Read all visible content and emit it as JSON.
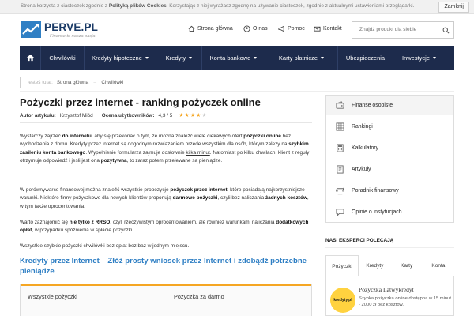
{
  "cookie": {
    "text_before": "Strona korzysta z ciasteczek zgodnie z ",
    "policy_link": "Polityką plików Cookies",
    "text_after": ". Korzystając z niej wyrażasz zgodnę na używanie ciasteczek, zgodnie z aktualnymi ustawieniami przeglądarki.",
    "close_label": "Zamknij"
  },
  "header": {
    "logo_name": "PERVE.PL",
    "logo_tagline": "Finanse to nasza pasja",
    "links": [
      {
        "label": "Strona główna",
        "icon": "home-icon"
      },
      {
        "label": "O nas",
        "icon": "user-icon"
      },
      {
        "label": "Pomoc",
        "icon": "megaphone-icon"
      },
      {
        "label": "Kontakt",
        "icon": "mail-icon"
      }
    ],
    "search_placeholder": "Znajdź produkt dla siebie"
  },
  "nav": {
    "items": [
      {
        "label": "Chwilówki",
        "dropdown": false
      },
      {
        "label": "Kredyty hipoteczne",
        "dropdown": true
      },
      {
        "label": "Kredyty",
        "dropdown": true
      },
      {
        "label": "Konta bankowe",
        "dropdown": true
      },
      {
        "label": "Karty płatnicze",
        "dropdown": true
      },
      {
        "label": "Ubezpieczenia",
        "dropdown": false
      },
      {
        "label": "Inwestycje",
        "dropdown": true
      }
    ]
  },
  "breadcrumb": {
    "prefix": "jesteś tutaj:",
    "items": [
      "Strona główna",
      "Chwilówki"
    ],
    "separator": "→"
  },
  "article": {
    "title": "Pożyczki przez internet - ranking pożyczek online",
    "author_label": "Autor artykułu:",
    "author": "Krzysztof Miód",
    "rating_label": "Ocena użytkowników:",
    "rating_value": "4,3 / 5",
    "rating_stars": 4.3,
    "p1": {
      "a": "Wystarczy zajrzeć ",
      "b": "do internetu",
      "c": ", aby się przekonać o tym, że można znaleźć wiele ciekawych ofert ",
      "d": "pożyczki online",
      "e": " bez wychodzenia z domu. Kredyty przez internet są dogodnym rozwiązaniem przede wszystkim dla osób, którym zależy na ",
      "f": "szybkim zasileniu konta bankowego",
      "g": ". Wypełnienie formularza zajmuje dosłownie ",
      "h": "kilka minut",
      "i": ". Natomiast po kilku chwilach, klient z reguły otrzymuje odpowiedź i jeśli jest ona ",
      "j": "pozytywna",
      "k": ", to zaraz potem przelewane są pieniądze."
    },
    "p2": {
      "a": "W porównywarce finansowej można znaleźć wszystkie propozycje ",
      "b": "pożyczek przez internet",
      "c": ", które posiadają najkorzystniejsze warunki. Niektóre firmy pożyczkowe dla nowych klientów proponują ",
      "d": "darmowe pożyczki",
      "e": ", czyli bez naliczania ",
      "f": "żadnych kosztów",
      "g": ", w tym także oprocentowania."
    },
    "p3": {
      "a": "Warto zaznajomić się ",
      "b": "nie tylko z RRSO",
      "c": ", czyli rzeczywistym oprocentowaniem, ale również warunkami naliczania ",
      "d": "dodatkowych opłat",
      "e": ", w przypadku spóźnienia w spłacie pożyczki."
    },
    "p4": "Wszystkie szybkie pożyczki chwilówki bez opłat bez baz w jednym miejscu.",
    "section_heading": "Kredyty przez Internet – Złóż prosty wniosek przez Internet i zdobądź potrzebne pieniądze",
    "tabs": [
      "Wszystkie pożyczki",
      "Pożyczka za darmo"
    ]
  },
  "sidebar": {
    "items": [
      {
        "label": "Finanse osobiste",
        "icon": "wallet-icon"
      },
      {
        "label": "Rankingi",
        "icon": "grid-icon"
      },
      {
        "label": "Kalkulatory",
        "icon": "calculator-icon"
      },
      {
        "label": "Artykuły",
        "icon": "book-icon"
      },
      {
        "label": "Poradnik finansowy",
        "icon": "scales-icon"
      },
      {
        "label": "Opinie o instytucjach",
        "icon": "chat-icon"
      }
    ],
    "experts_label": "NASI EKSPERCI POLECAJĄ",
    "tabs": [
      "Pożyczki",
      "Kredyty",
      "Karty",
      "Konta"
    ],
    "offer": {
      "logo_text": "kredyty.pl",
      "title": "Pożyczka Latwykredyt",
      "desc": "Szybka pożyczka online dostępna w 15 minut - 2000 zł bez kosztów."
    }
  },
  "colors": {
    "nav_bg": "#1d2b4c",
    "heading_blue": "#2f7fc4",
    "star": "#f5a623",
    "tab_accent": "#f5a623"
  }
}
